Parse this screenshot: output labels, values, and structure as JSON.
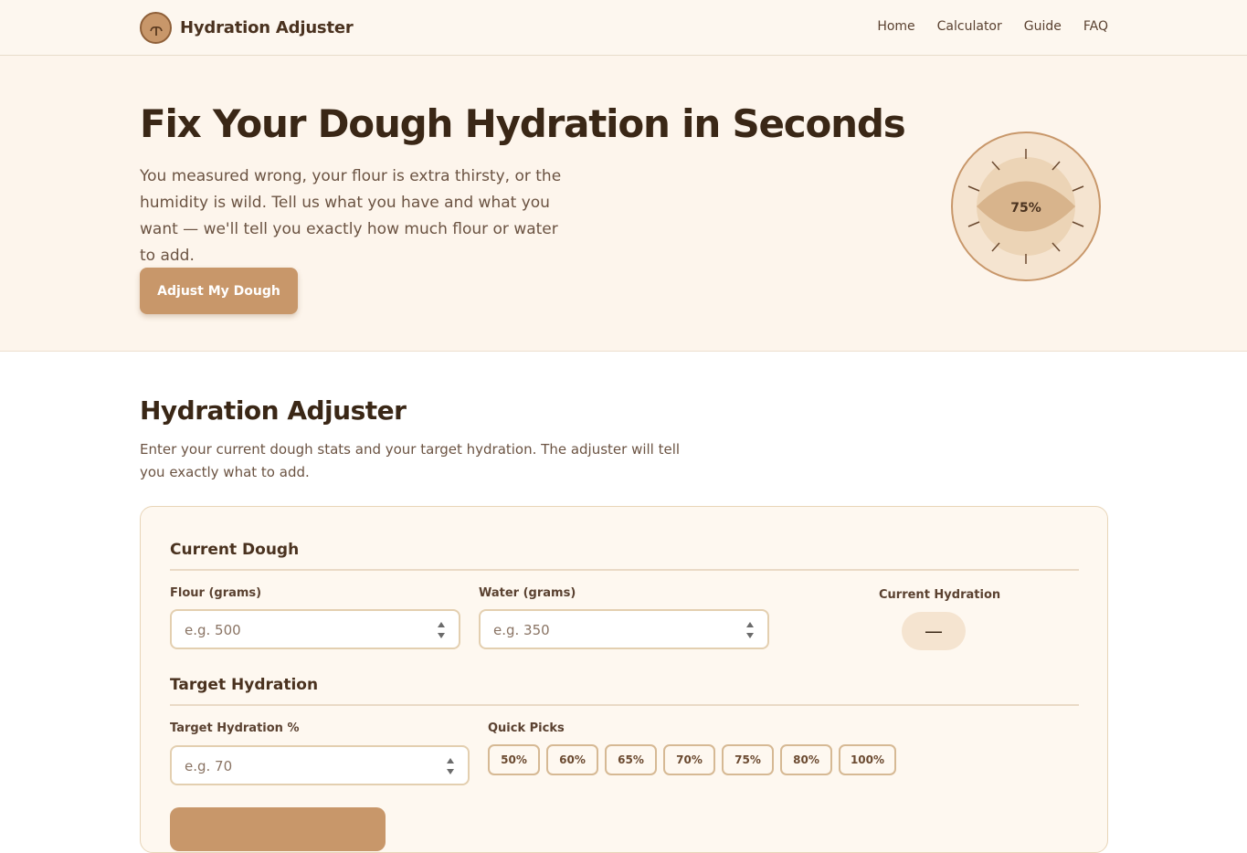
{
  "nav": {
    "brand": "Hydration Adjuster",
    "logo_icon": "wheat-sprout-icon",
    "links": [
      "Home",
      "Calculator",
      "Guide",
      "FAQ"
    ]
  },
  "hero": {
    "title": "Fix Your Dough Hydration in Seconds",
    "subtitle": "You measured wrong, your flour is extra thirsty, or the humidity is wild. Tell us what you have and what you want — we'll tell you exactly how much flour or water to add.",
    "cta": "Adjust My Dough",
    "gauge_value": "75%"
  },
  "adjuster": {
    "title": "Hydration Adjuster",
    "description": "Enter your current dough stats and your target hydration. The adjuster will tell you exactly what to add.",
    "current_group": "Current Dough",
    "flour_label": "Flour (grams)",
    "flour_placeholder": "e.g. 500",
    "water_label": "Water (grams)",
    "water_placeholder": "e.g. 350",
    "current_hydration_label": "Current Hydration",
    "current_hydration_value": "—",
    "target_group": "Target Hydration",
    "target_label": "Target Hydration %",
    "target_placeholder": "e.g. 70",
    "quick_picks_label": "Quick Picks",
    "quick_picks": [
      "50%",
      "60%",
      "65%",
      "70%",
      "75%",
      "80%",
      "100%"
    ]
  },
  "colors": {
    "accent": "#c8976a",
    "background_hero": "#fdf5ec",
    "text_dark": "#3a2716"
  }
}
